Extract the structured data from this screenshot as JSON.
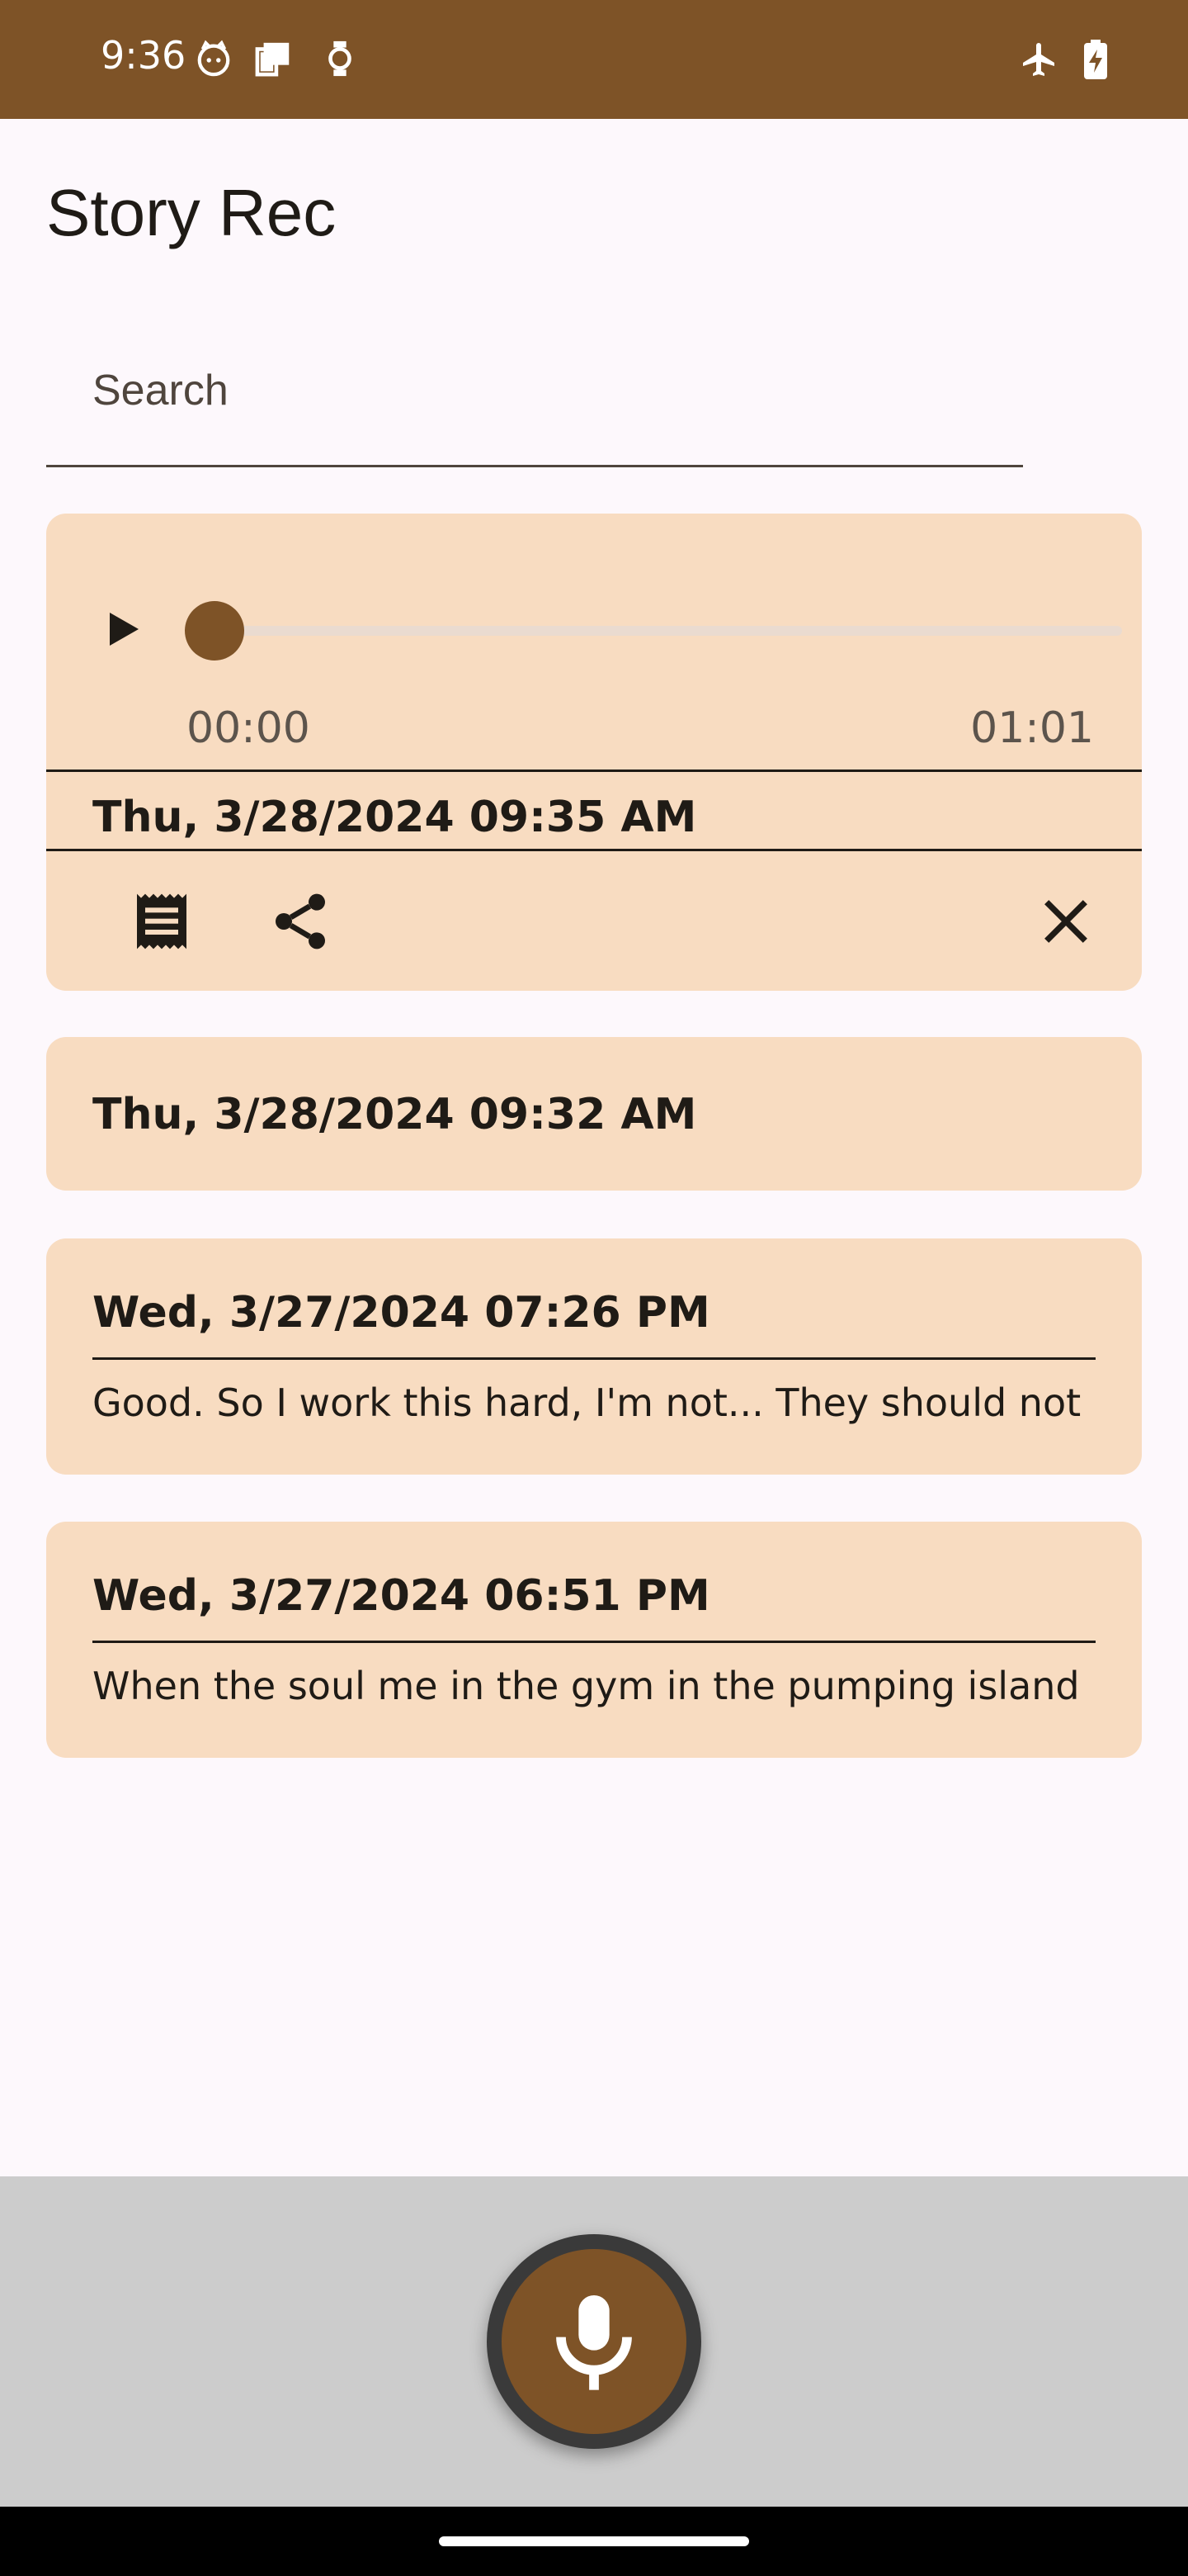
{
  "status_bar": {
    "time": "9:36",
    "icons": [
      "cat-face-icon",
      "device-icon",
      "watch-icon",
      "airplane-mode-icon",
      "battery-charging-icon"
    ]
  },
  "app": {
    "title": "Story Rec"
  },
  "search": {
    "placeholder": "Search",
    "value": ""
  },
  "player": {
    "position": "00:00",
    "duration": "01:01",
    "progress": 0
  },
  "recordings": [
    {
      "date": "Thu, 3/28/2024 09:35 AM",
      "snippet": "",
      "expanded": true
    },
    {
      "date": "Thu, 3/28/2024 09:32 AM",
      "snippet": ""
    },
    {
      "date": "Wed, 3/27/2024 07:26 PM",
      "snippet": "Good. So I work this hard, I'm not... They should not"
    },
    {
      "date": "Wed, 3/27/2024 06:51 PM",
      "snippet": "When the soul me in the gym in the pumping island"
    }
  ],
  "actions": {
    "transcript_icon": "receipt-icon",
    "share_icon": "share-icon",
    "close_icon": "close-icon"
  },
  "record_button": {
    "icon": "microphone-icon"
  },
  "colors": {
    "primary": "#7e5327",
    "card": "#f8dcc1",
    "background": "#fdf8fc",
    "bottom_bar": "#cccccc"
  }
}
